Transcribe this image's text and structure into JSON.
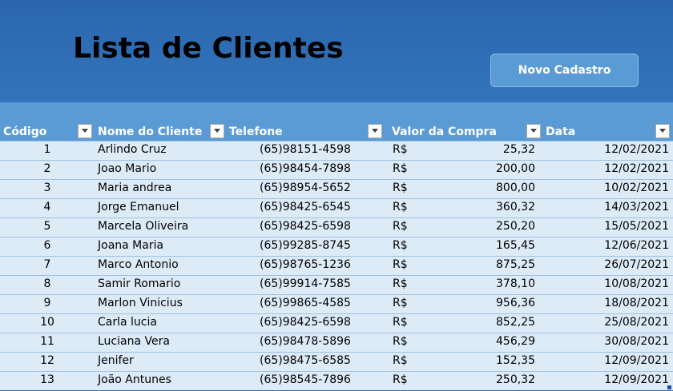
{
  "header": {
    "title": "Lista de Clientes",
    "new_button_label": "Novo Cadastro"
  },
  "table": {
    "columns": [
      "Código",
      "Nome do Cliente",
      "Telefone",
      "Valor da Compra",
      "Data"
    ],
    "rows": [
      {
        "codigo": "1",
        "nome": "Arlindo Cruz",
        "telefone": "(65)98151-4598",
        "moeda": "R$",
        "valor": "25,32",
        "data": "12/02/2021"
      },
      {
        "codigo": "2",
        "nome": "Joao Mario",
        "telefone": "(65)98454-7898",
        "moeda": "R$",
        "valor": "200,00",
        "data": "12/02/2021"
      },
      {
        "codigo": "3",
        "nome": "Maria andrea",
        "telefone": "(65)98954-5652",
        "moeda": "R$",
        "valor": "800,00",
        "data": "10/02/2021"
      },
      {
        "codigo": "4",
        "nome": "Jorge Emanuel",
        "telefone": "(65)98425-6545",
        "moeda": "R$",
        "valor": "360,32",
        "data": "14/03/2021"
      },
      {
        "codigo": "5",
        "nome": "Marcela Oliveira",
        "telefone": "(65)98425-6598",
        "moeda": "R$",
        "valor": "250,20",
        "data": "15/05/2021"
      },
      {
        "codigo": "6",
        "nome": "Joana Maria",
        "telefone": "(65)99285-8745",
        "moeda": "R$",
        "valor": "165,45",
        "data": "12/06/2021"
      },
      {
        "codigo": "7",
        "nome": "Marco Antonio",
        "telefone": "(65)98765-1236",
        "moeda": "R$",
        "valor": "875,25",
        "data": "26/07/2021"
      },
      {
        "codigo": "8",
        "nome": "Samir Romario",
        "telefone": "(65)99914-7585",
        "moeda": "R$",
        "valor": "378,10",
        "data": "10/08/2021"
      },
      {
        "codigo": "9",
        "nome": "Marlon Vinicius",
        "telefone": "(65)99865-4585",
        "moeda": "R$",
        "valor": "956,36",
        "data": "18/08/2021"
      },
      {
        "codigo": "10",
        "nome": "Carla lucia",
        "telefone": "(65)98425-6598",
        "moeda": "R$",
        "valor": "852,25",
        "data": "25/08/2021"
      },
      {
        "codigo": "11",
        "nome": "Luciana Vera",
        "telefone": "(65)98478-5896",
        "moeda": "R$",
        "valor": "456,29",
        "data": "30/08/2021"
      },
      {
        "codigo": "12",
        "nome": "Jenifer",
        "telefone": "(65)98475-6585",
        "moeda": "R$",
        "valor": "152,35",
        "data": "12/09/2021"
      },
      {
        "codigo": "13",
        "nome": "João Antunes",
        "telefone": "(65)98545-7896",
        "moeda": "R$",
        "valor": "250,32",
        "data": "12/09/2021"
      }
    ]
  },
  "colors": {
    "banner": "#2f6fb3",
    "header_row": "#5b9bd5",
    "data_row": "#ddebf7",
    "button": "#5b9bd5"
  }
}
